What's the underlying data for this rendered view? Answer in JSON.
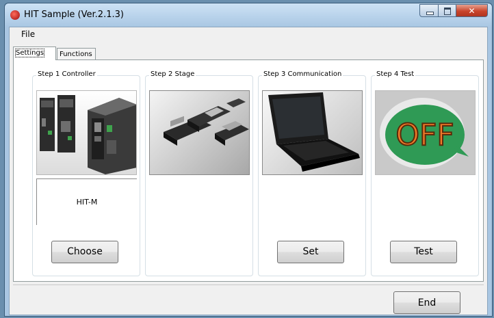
{
  "window": {
    "title": "HIT Sample (Ver.2.1.3)"
  },
  "menu": {
    "file_label": "File"
  },
  "tabs": [
    {
      "label": "Settings",
      "active": true
    },
    {
      "label": "Functions",
      "active": false
    }
  ],
  "steps": [
    {
      "label": "Step 1  Controller",
      "image": "controller-image",
      "model": "HIT-M",
      "button_label": "Choose"
    },
    {
      "label": "Step 2  Stage",
      "image": "stage-image"
    },
    {
      "label": "Step 3  Communication",
      "image": "laptop-image",
      "button_label": "Set"
    },
    {
      "label": "Step 4  Test",
      "image": "off-status-image",
      "status_text": "OFF",
      "button_label": "Test"
    }
  ],
  "footer": {
    "end_label": "End"
  },
  "colors": {
    "title_bar": "#cde2f5",
    "close_button": "#c9452c",
    "off_badge_green": "#2f9a55",
    "off_text_orange": "#f07a2a"
  }
}
